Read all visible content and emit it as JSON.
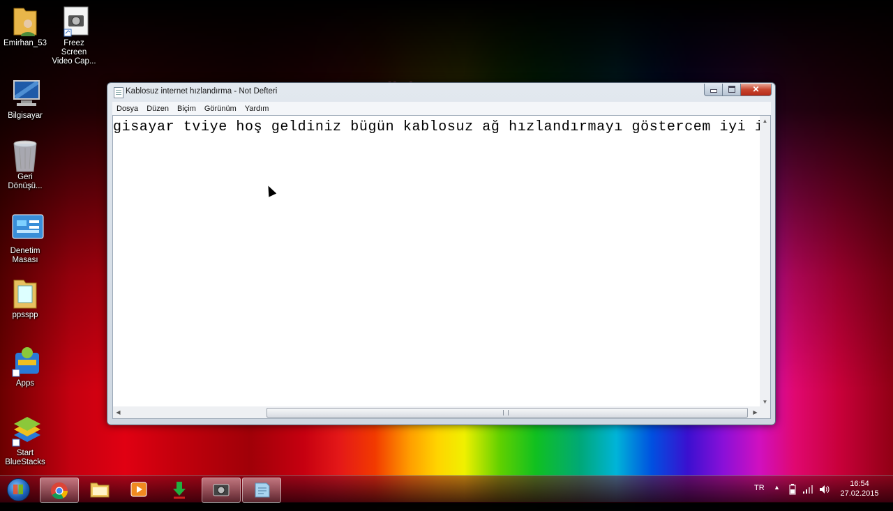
{
  "desktop": {
    "icons": [
      {
        "label": "Emirhan_53",
        "icon": "user-folder-icon"
      },
      {
        "label": "Freez Screen Video Cap...",
        "icon": "camera-icon"
      },
      {
        "label": "Bilgisayar",
        "icon": "computer-icon"
      },
      {
        "label": "Geri Dönüşü...",
        "icon": "recycle-bin-icon"
      },
      {
        "label": "Denetim Masası",
        "icon": "control-panel-icon"
      },
      {
        "label": "ppsspp",
        "icon": "folder-icon"
      },
      {
        "label": "Apps",
        "icon": "bluestacks-apps-icon"
      },
      {
        "label": "Start BlueStacks",
        "icon": "bluestacks-icon"
      }
    ],
    "watermark": "Bilgisayar Tv"
  },
  "window": {
    "title": "Kablosuz internet hızlandırma - Not Defteri",
    "menu": [
      "Dosya",
      "Düzen",
      "Biçim",
      "Görünüm",
      "Yardım"
    ],
    "content": "gisayar tviye hoş geldiniz bügün kablosuz ağ hızlandırmayı göstercem iyi izl"
  },
  "taskbar": {
    "apps": [
      {
        "name": "chrome",
        "icon": "chrome-icon",
        "active": true
      },
      {
        "name": "explorer",
        "icon": "folder-icon",
        "active": false
      },
      {
        "name": "media",
        "icon": "media-player-icon",
        "active": false
      },
      {
        "name": "download",
        "icon": "download-icon",
        "active": false
      },
      {
        "name": "freez",
        "icon": "camera-icon",
        "active": true
      },
      {
        "name": "notepad",
        "icon": "notepad-icon",
        "active": true
      }
    ],
    "language": "TR",
    "time": "16:54",
    "date": "27.02.2015"
  }
}
